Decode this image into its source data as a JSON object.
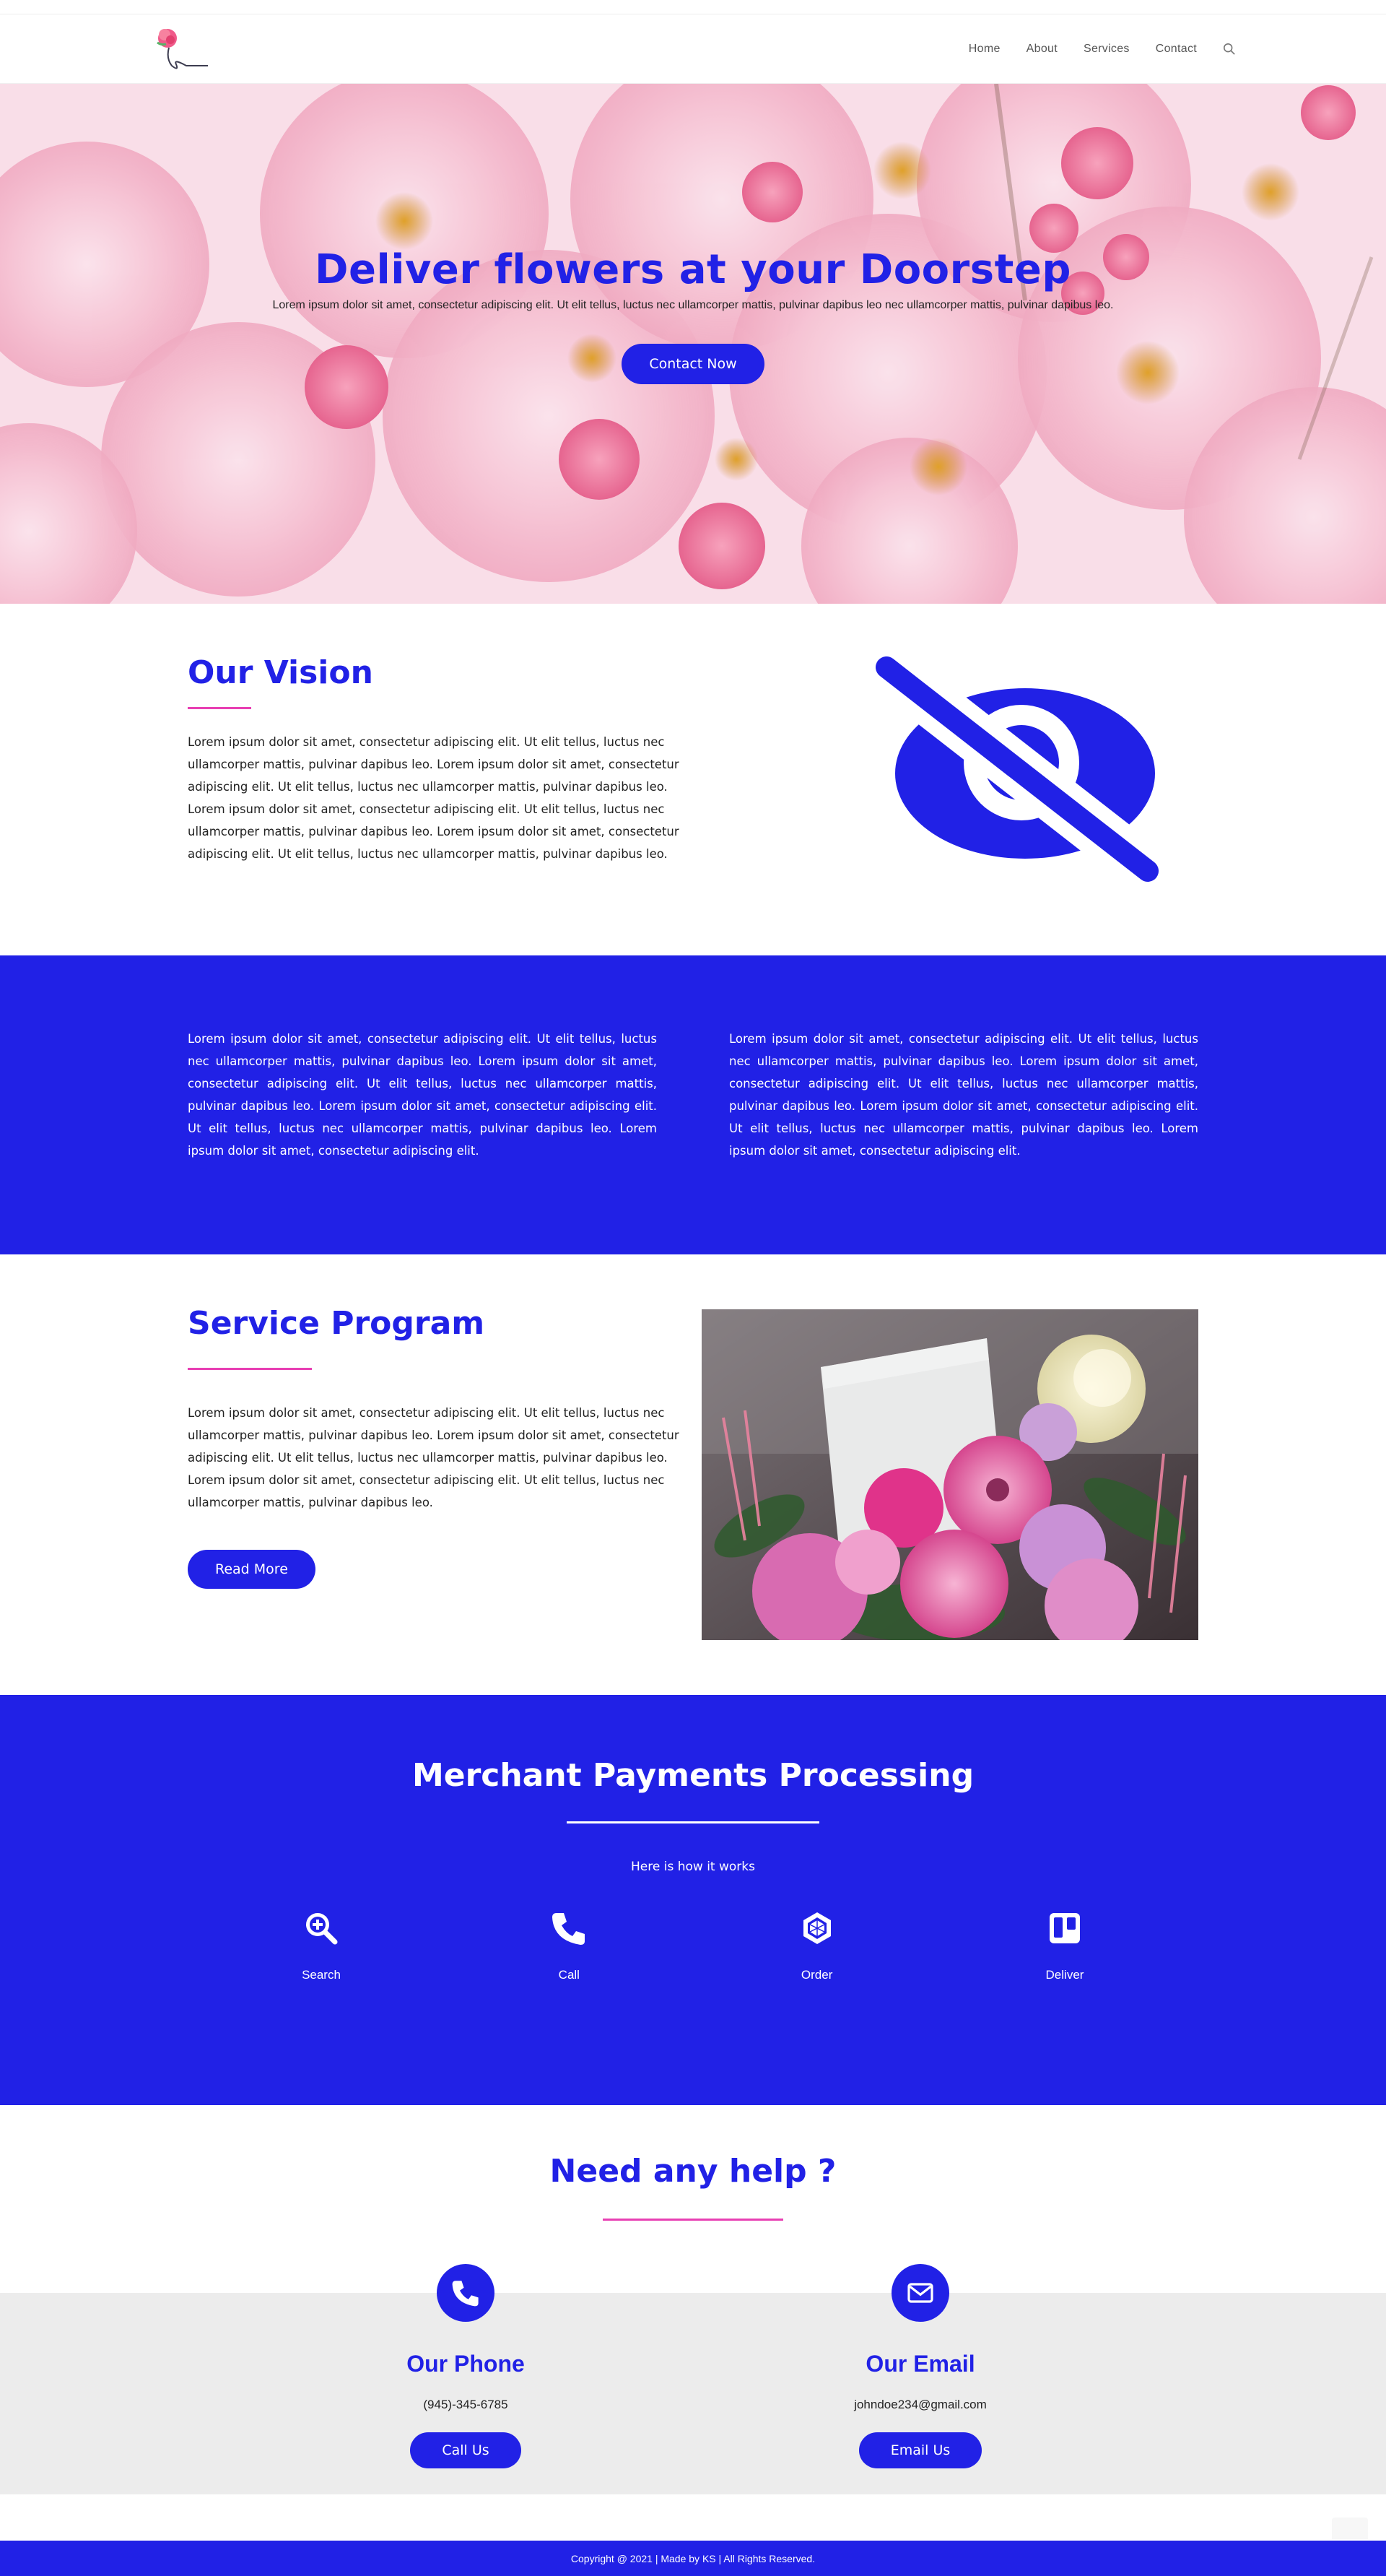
{
  "brand": {
    "accent": "#2121e6",
    "pink": "#e83fb3"
  },
  "nav": {
    "items": [
      "Home",
      "About",
      "Services",
      "Contact"
    ],
    "search_icon": "search-icon"
  },
  "hero": {
    "title": "Deliver flowers at your Doorstep",
    "subtitle": "Lorem ipsum dolor sit amet, consectetur adipiscing elit. Ut elit tellus, luctus nec ullamcorper mattis, pulvinar dapibus leo nec ullamcorper mattis, pulvinar dapibus leo.",
    "button": "Contact Now"
  },
  "vision": {
    "title": "Our Vision",
    "text": "Lorem ipsum dolor sit amet, consectetur adipiscing elit. Ut elit tellus, luctus nec ullamcorper mattis, pulvinar dapibus leo. Lorem ipsum dolor sit amet, consectetur adipiscing elit. Ut elit tellus, luctus nec ullamcorper mattis, pulvinar dapibus leo. Lorem ipsum dolor sit amet, consectetur adipiscing elit. Ut elit tellus, luctus nec ullamcorper mattis, pulvinar dapibus leo. Lorem ipsum dolor sit amet, consectetur adipiscing elit. Ut elit tellus, luctus nec ullamcorper mattis, pulvinar dapibus leo.",
    "icon": "eye-slash-icon"
  },
  "band": {
    "left": "Lorem ipsum dolor sit amet, consectetur adipiscing elit. Ut elit tellus, luctus nec ullamcorper mattis, pulvinar dapibus leo. Lorem ipsum dolor sit amet, consectetur adipiscing elit. Ut elit tellus, luctus nec ullamcorper mattis, pulvinar dapibus leo. Lorem ipsum dolor sit amet, consectetur adipiscing elit. Ut elit tellus, luctus nec ullamcorper mattis, pulvinar dapibus leo. Lorem ipsum dolor sit amet, consectetur adipiscing elit.",
    "right": "Lorem ipsum dolor sit amet, consectetur adipiscing elit. Ut elit tellus, luctus nec ullamcorper mattis, pulvinar dapibus leo. Lorem ipsum dolor sit amet, consectetur adipiscing elit. Ut elit tellus, luctus nec ullamcorper mattis, pulvinar dapibus leo. Lorem ipsum dolor sit amet, consectetur adipiscing elit. Ut elit tellus, luctus nec ullamcorper mattis, pulvinar dapibus leo. Lorem ipsum dolor sit amet, consectetur adipiscing elit."
  },
  "service": {
    "title": "Service Program",
    "text": "Lorem ipsum dolor sit amet, consectetur adipiscing elit. Ut elit tellus, luctus nec ullamcorper mattis, pulvinar dapibus leo. Lorem ipsum dolor sit amet, consectetur adipiscing elit. Ut elit tellus, luctus nec ullamcorper mattis, pulvinar dapibus leo. Lorem ipsum dolor sit amet, consectetur adipiscing elit. Ut elit tellus, luctus nec ullamcorper mattis, pulvinar dapibus leo.",
    "button": "Read More"
  },
  "merchant": {
    "title": "Merchant Payments Processing",
    "subtitle": "Here is how it works",
    "steps": [
      {
        "label": "Search",
        "icon": "search-plus-icon"
      },
      {
        "label": "Call",
        "icon": "phone-icon"
      },
      {
        "label": "Order",
        "icon": "hexagon-icon"
      },
      {
        "label": "Deliver",
        "icon": "trello-icon"
      }
    ]
  },
  "help": {
    "title": "Need any help ?",
    "phone": {
      "title": "Our Phone",
      "value": "(945)-345-6785",
      "button": "Call Us",
      "icon": "phone-icon"
    },
    "email": {
      "title": "Our Email",
      "value": "johndoe234@gmail.com",
      "button": "Email Us",
      "icon": "envelope-icon"
    }
  },
  "footer": {
    "text": "Copyright @ 2021 | Made by KS | All Rights Reserved."
  }
}
